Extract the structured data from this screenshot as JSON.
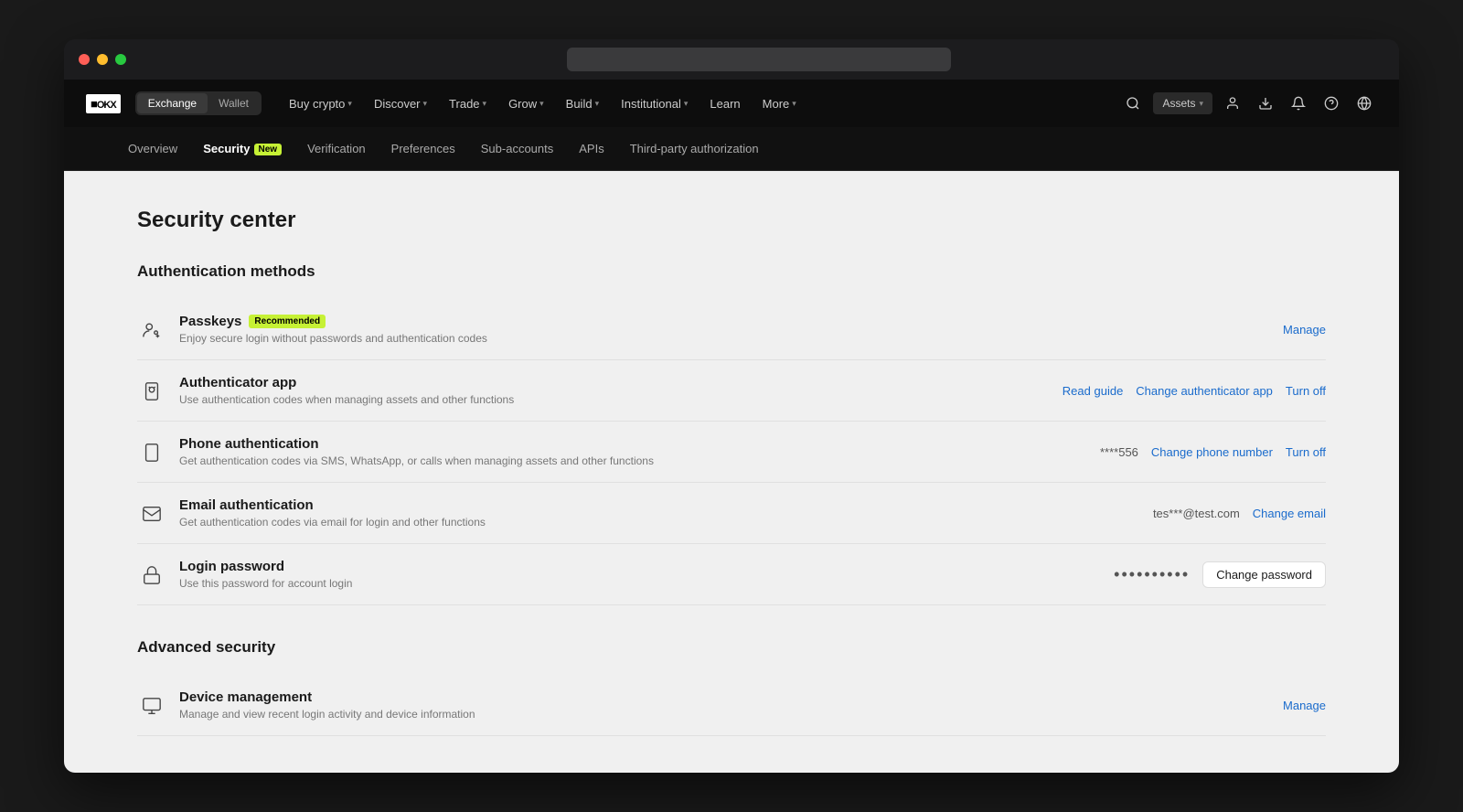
{
  "window": {
    "url_placeholder": ""
  },
  "navbar": {
    "logo": "OKX",
    "toggle": {
      "exchange": "Exchange",
      "wallet": "Wallet"
    },
    "nav_items": [
      {
        "label": "Buy crypto",
        "has_chevron": true
      },
      {
        "label": "Discover",
        "has_chevron": true
      },
      {
        "label": "Trade",
        "has_chevron": true
      },
      {
        "label": "Grow",
        "has_chevron": true
      },
      {
        "label": "Build",
        "has_chevron": true
      },
      {
        "label": "Institutional",
        "has_chevron": true
      },
      {
        "label": "Learn",
        "has_chevron": false
      },
      {
        "label": "More",
        "has_chevron": true
      }
    ],
    "assets_btn": "Assets"
  },
  "subnav": {
    "items": [
      {
        "label": "Overview",
        "active": false
      },
      {
        "label": "Security",
        "active": true,
        "badge": "New"
      },
      {
        "label": "Verification",
        "active": false
      },
      {
        "label": "Preferences",
        "active": false
      },
      {
        "label": "Sub-accounts",
        "active": false
      },
      {
        "label": "APIs",
        "active": false
      },
      {
        "label": "Third-party authorization",
        "active": false
      }
    ]
  },
  "main": {
    "page_title": "Security center",
    "auth_section_title": "Authentication methods",
    "auth_items": [
      {
        "id": "passkeys",
        "name": "Passkeys",
        "badge": "Recommended",
        "desc": "Enjoy secure login without passwords and authentication codes",
        "actions": [
          {
            "label": "Manage",
            "type": "link"
          }
        ],
        "value": null,
        "icon": "passkey"
      },
      {
        "id": "authenticator",
        "name": "Authenticator app",
        "badge": null,
        "desc": "Use authentication codes when managing assets and other functions",
        "actions": [
          {
            "label": "Read guide",
            "type": "link"
          },
          {
            "label": "Change authenticator app",
            "type": "link"
          },
          {
            "label": "Turn off",
            "type": "link"
          }
        ],
        "value": null,
        "icon": "authenticator"
      },
      {
        "id": "phone",
        "name": "Phone authentication",
        "badge": null,
        "desc": "Get authentication codes via SMS, WhatsApp, or calls when managing assets and other functions",
        "actions": [
          {
            "label": "Change phone number",
            "type": "link"
          },
          {
            "label": "Turn off",
            "type": "link"
          }
        ],
        "value": "****556",
        "icon": "phone"
      },
      {
        "id": "email",
        "name": "Email authentication",
        "badge": null,
        "desc": "Get authentication codes via email for login and other functions",
        "actions": [
          {
            "label": "Change email",
            "type": "link"
          }
        ],
        "value": "tes***@test.com",
        "icon": "email"
      },
      {
        "id": "password",
        "name": "Login password",
        "badge": null,
        "desc": "Use this password for account login",
        "actions": [
          {
            "label": "Change password",
            "type": "button"
          }
        ],
        "value": "••••••••••",
        "icon": "lock"
      }
    ],
    "advanced_section_title": "Advanced security",
    "advanced_items": [
      {
        "id": "device",
        "name": "Device management",
        "badge": null,
        "desc": "Manage and view recent login activity and device information",
        "actions": [
          {
            "label": "Manage",
            "type": "link"
          }
        ],
        "icon": "device"
      }
    ]
  }
}
